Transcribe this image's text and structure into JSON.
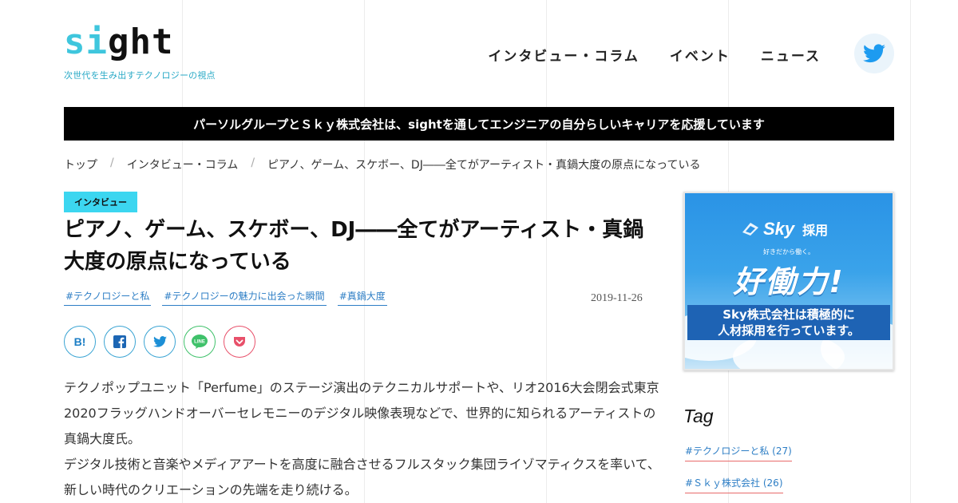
{
  "logo": {
    "mark_part1": "si",
    "mark_part2": "ght",
    "tagline": "次世代を生み出すテクノロジーの視点"
  },
  "nav": {
    "items": [
      "インタビュー・コラム",
      "イベント",
      "ニュース"
    ]
  },
  "header_icon": "twitter-icon",
  "banner": {
    "text": "パーソルグループとＳｋｙ株式会社は、sightを通してエンジニアの自分らしいキャリアを応援しています"
  },
  "breadcrumb": {
    "items": [
      "トップ",
      "インタビュー・コラム",
      "ピアノ、ゲーム、スケボー、DJ――全てがアーティスト・真鍋大度の原点になっている"
    ],
    "separator": "/"
  },
  "article": {
    "category": "インタビュー",
    "title": "ピアノ、ゲーム、スケボー、DJ――全てがアーティスト・真鍋大度の原点になっている",
    "tags": [
      "#テクノロジーと私",
      "#テクノロジーの魅力に出会った瞬間",
      "#真鍋大度"
    ],
    "date": "2019-11-26",
    "share_buttons": [
      {
        "icon": "hatena-bookmark-icon",
        "label": "B!"
      },
      {
        "icon": "facebook-icon"
      },
      {
        "icon": "twitter-icon"
      },
      {
        "icon": "line-icon",
        "label": "LINE"
      },
      {
        "icon": "pocket-icon"
      }
    ],
    "paragraphs": [
      "テクノポップユニット「Perfume」のステージ演出のテクニカルサポートや、リオ2016大会閉会式東京2020フラッグハンドオーバーセレモニーのデジタル映像表現などで、世界的に知られるアーティストの真鍋大度氏。",
      "デジタル技術と音楽やメディアアートを高度に融合させるフルスタック集団ライゾマティクスを率いて、新しい時代のクリエーションの先端を走り続ける。"
    ]
  },
  "sidebar": {
    "ad": {
      "brand": "Sky",
      "brand_suffix": "採用",
      "sub": "好きだから働く。",
      "headline": "好働力!",
      "box_line1": "Sky株式会社は積極的に",
      "box_line2": "人材採用を行っています。"
    },
    "tag_heading": "Tag",
    "tags": [
      "#テクノロジーと私 (27)",
      "#Ｓｋｙ株式会社 (26)"
    ]
  },
  "colors": {
    "accent_cyan": "#3cd6f0",
    "link_blue": "#2d7ec5",
    "banner_black": "#000000"
  }
}
